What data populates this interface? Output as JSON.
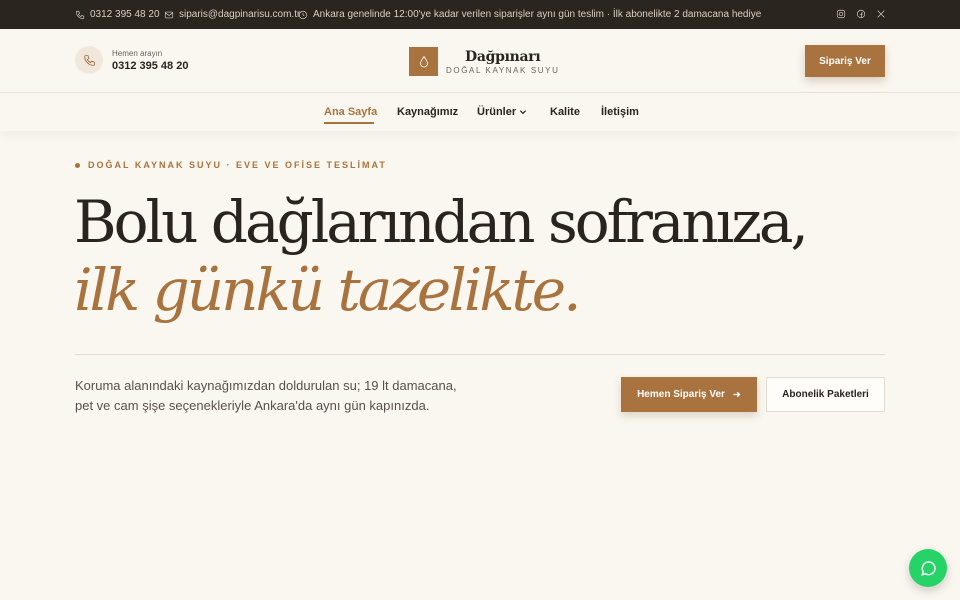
{
  "topbar": {
    "phone": "0312 395 48 20",
    "email": "siparis@dagpinarisu.com.tr",
    "notice": "Ankara genelinde 12:00'ye kadar verilen siparişler aynı gün teslim · İlk abonelikte 2 damacana hediye",
    "social": [
      "instagram-icon",
      "facebook-icon",
      "x-icon"
    ]
  },
  "header": {
    "call_label": "Hemen arayın",
    "call_phone": "0312 395 48 20",
    "logo_name": "Dağpınarı",
    "logo_tagline": "DOĞAL KAYNAK SUYU",
    "order_button": "Sipariş Ver"
  },
  "nav": {
    "items": [
      {
        "label": "Ana Sayfa",
        "active": true
      },
      {
        "label": "Kaynağımız"
      },
      {
        "label": "Ürünler",
        "has_dropdown": true
      },
      {
        "label": "Kalite"
      },
      {
        "label": "İletişim"
      }
    ]
  },
  "hero": {
    "eyebrow": "DOĞAL KAYNAK SUYU · EVE VE OFİSE TESLİMAT",
    "title_line1": "Bolu dağlarından sofranıza,",
    "title_line2": "ilk günkü tazelikte.",
    "lead": "Koruma alanındaki kaynağımızdan doldurulan su; 19 lt damacana, pet ve cam şişe seçenekleriyle Ankara'da aynı gün kapınızda.",
    "primary_cta": "Hemen Sipariş Ver",
    "secondary_cta": "Abonelik Paketleri"
  },
  "colors": {
    "accent": "#a8733f",
    "topbar_bg": "#2b2520",
    "page_bg": "#faf7f0",
    "whatsapp": "#25d366"
  },
  "floating": {
    "icon": "whatsapp-icon"
  }
}
